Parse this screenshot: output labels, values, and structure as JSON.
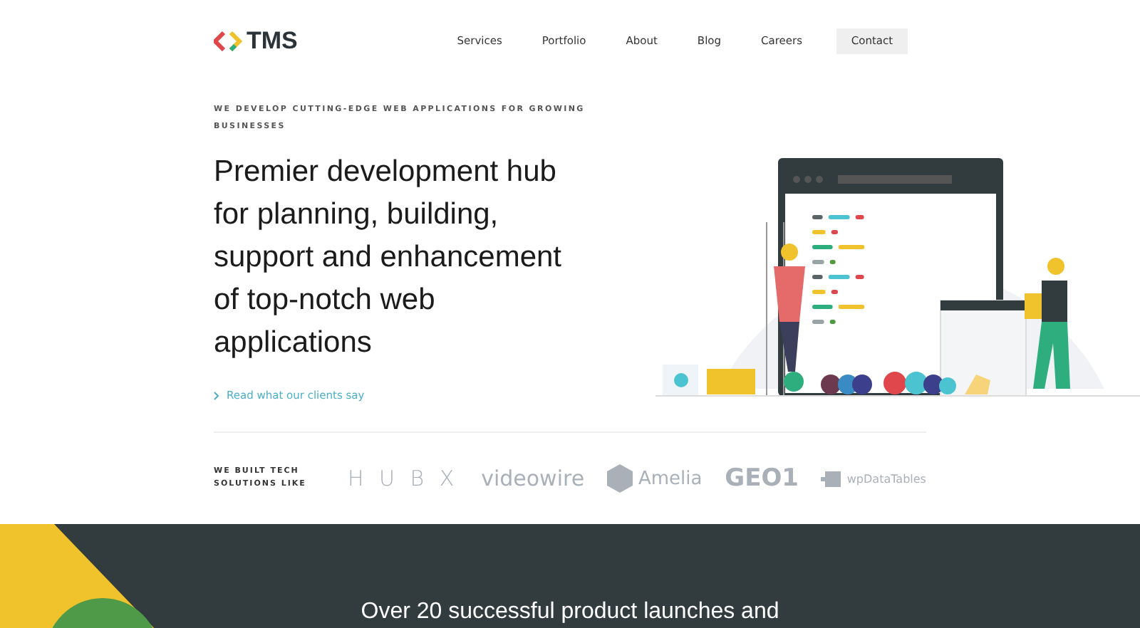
{
  "header": {
    "logo": "TMS",
    "nav": [
      {
        "label": "Services",
        "kind": "link"
      },
      {
        "label": "Portfolio",
        "kind": "link"
      },
      {
        "label": "About",
        "kind": "link"
      },
      {
        "label": "Blog",
        "kind": "link"
      },
      {
        "label": "Careers",
        "kind": "link"
      },
      {
        "label": "Contact",
        "kind": "button"
      }
    ]
  },
  "hero": {
    "eyebrow": "WE DEVELOP CUTTING-EDGE WEB APPLICATIONS FOR GROWING BUSINESSES",
    "headline": "Premier development hub for planning, building, support and enhancement of top-notch web applications",
    "link": "Read what our clients say"
  },
  "clients": {
    "label": "WE BUILT TECH SOLUTIONS LIKE",
    "logos": [
      {
        "name": "H U B X",
        "kind": "hubx"
      },
      {
        "name": "videowire",
        "kind": "videowire"
      },
      {
        "name": "Amelia",
        "kind": "amelia"
      },
      {
        "name": "GEO1",
        "kind": "geo"
      },
      {
        "name": "wpDataTables",
        "kind": "wpdt"
      }
    ]
  },
  "stats": {
    "heading": "Over 20 successful product launches and"
  }
}
